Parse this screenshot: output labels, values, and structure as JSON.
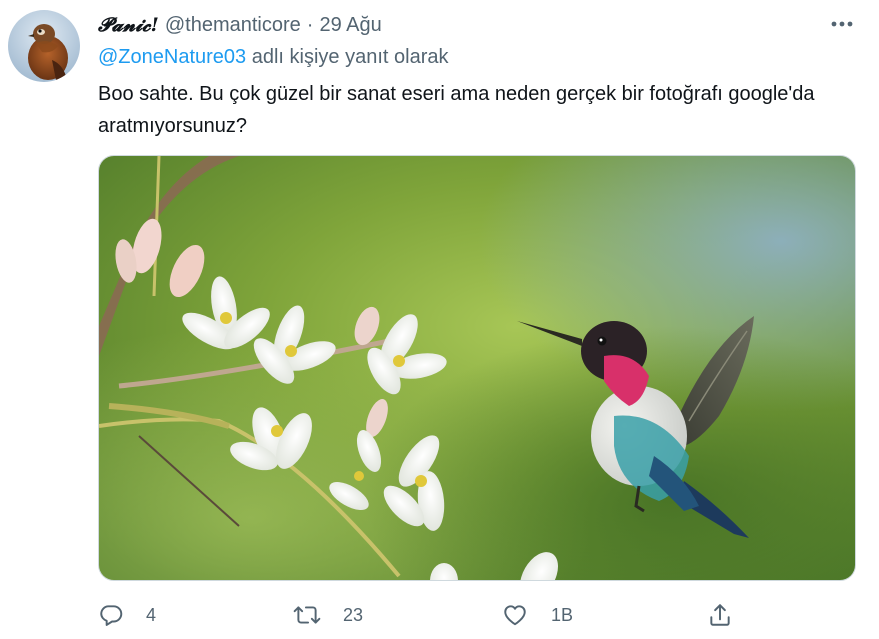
{
  "tweet": {
    "display_name": "𝓟𝓪𝓷𝓲𝓬!",
    "handle": "@themanticore",
    "separator": "·",
    "date": "29 Ağu",
    "reply_to_mention": "@ZoneNature03",
    "reply_to_suffix": " adlı kişiye yanıt olarak",
    "text": "Boo sahte. Bu çok güzel bir sanat eseri ama neden gerçek bir fotoğrafı google'da aratmıyorsunuz?",
    "avatar_icon": "bird-avatar",
    "more_icon": "more-horizontal-icon"
  },
  "actions": {
    "reply_count": "4",
    "retweet_count": "23",
    "like_count": "1B",
    "reply_icon": "reply-icon",
    "retweet_icon": "retweet-icon",
    "like_icon": "heart-icon",
    "share_icon": "share-icon"
  },
  "colors": {
    "text_primary": "#0f1419",
    "text_secondary": "#536471",
    "link": "#1d9bf0",
    "border": "#cfd9de"
  }
}
